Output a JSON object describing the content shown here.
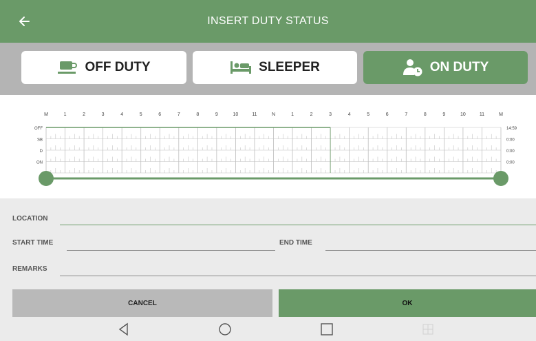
{
  "header": {
    "title": "INSERT DUTY STATUS",
    "back_icon": "arrow-left-icon"
  },
  "statuses": [
    {
      "label": "OFF DUTY",
      "icon": "coffee-cup-icon",
      "active": false
    },
    {
      "label": "SLEEPER",
      "icon": "bed-icon",
      "active": false
    },
    {
      "label": "ON DUTY",
      "icon": "person-clock-icon",
      "active": true
    }
  ],
  "log_graph": {
    "hour_labels": [
      "M",
      "1",
      "2",
      "3",
      "4",
      "5",
      "6",
      "7",
      "8",
      "9",
      "10",
      "11",
      "N",
      "1",
      "2",
      "3",
      "4",
      "5",
      "6",
      "7",
      "8",
      "9",
      "10",
      "11",
      "M"
    ],
    "row_labels": [
      "OFF",
      "SB",
      "D",
      "ON"
    ],
    "row_totals": [
      "14:59",
      "0:00",
      "0:00",
      "0:00"
    ],
    "off_duty_until_hour": 15,
    "range_slider": {
      "start_fraction": 0.0,
      "end_fraction": 1.0
    }
  },
  "form": {
    "location_label": "LOCATION",
    "location_value": "",
    "start_time_label": "START TIME",
    "start_time_value": "",
    "end_time_label": "END TIME",
    "end_time_value": "",
    "remarks_label": "REMARKS",
    "remarks_value": ""
  },
  "actions": {
    "cancel_label": "CANCEL",
    "ok_label": "OK"
  },
  "colors": {
    "accent": "#6a9a68",
    "status_bar": "#b4b4b4",
    "form_bg": "#ebebeb"
  },
  "navbar": {
    "icons": [
      "back-triangle-icon",
      "home-circle-icon",
      "recents-square-icon",
      "apps-grid-icon"
    ]
  }
}
